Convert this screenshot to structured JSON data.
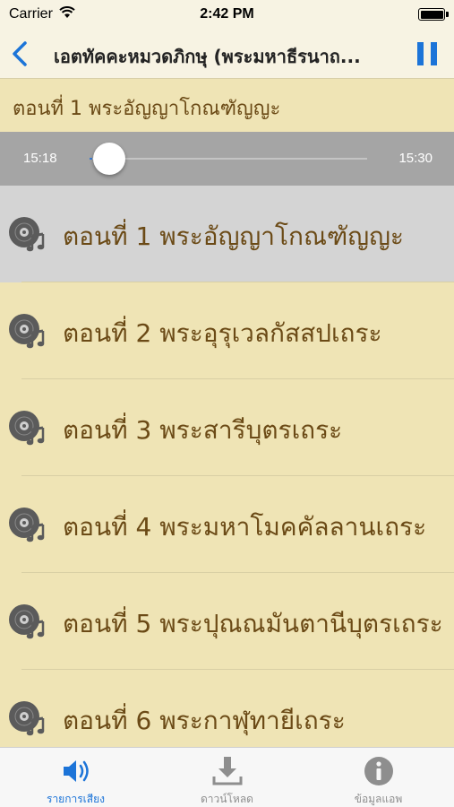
{
  "status": {
    "carrier": "Carrier",
    "time": "2:42 PM"
  },
  "nav": {
    "title": "เอตทัคคะหมวดภิกษุ (พระมหาธีรนาถ..."
  },
  "now_playing": {
    "title": "ตอนที่ 1 พระอัญญาโกณฑัญญะ"
  },
  "player": {
    "current_time": "15:18",
    "total_time": "15:30",
    "progress": 0.01
  },
  "episodes": [
    {
      "label": "ตอนที่ 1 พระอัญญาโกณฑัญญะ"
    },
    {
      "label": "ตอนที่ 2 พระอุรุเวลกัสสปเถระ"
    },
    {
      "label": "ตอนที่ 3 พระสารีบุตรเถระ"
    },
    {
      "label": "ตอนที่ 4 พระมหาโมคคัลลานเถระ"
    },
    {
      "label": "ตอนที่ 5 พระปุณณมันตานีบุตรเถระ"
    },
    {
      "label": "ตอนที่ 6 พระกาฬุทายีเถระ"
    }
  ],
  "tabs": [
    {
      "label": "รายการเสียง",
      "icon": "speaker-icon"
    },
    {
      "label": "ดาวน์โหลด",
      "icon": "download-icon"
    },
    {
      "label": "ข้อมูลแอพ",
      "icon": "info-icon"
    }
  ],
  "colors": {
    "accent": "#1c74d8",
    "background": "#efe4b5",
    "text": "#6b4a16",
    "active_row": "#d4d4d4"
  }
}
